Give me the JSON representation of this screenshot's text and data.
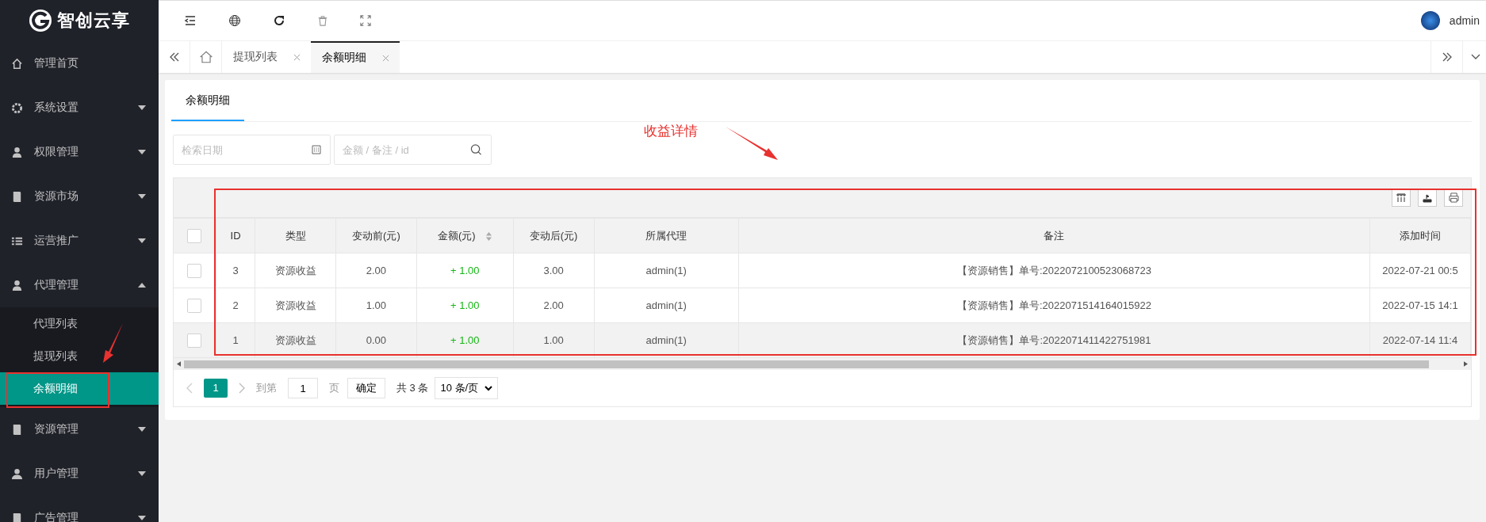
{
  "logo": {
    "text": "智创云享"
  },
  "sidebar": {
    "items": [
      {
        "label": "管理首页"
      },
      {
        "label": "系统设置",
        "expanded": false
      },
      {
        "label": "权限管理",
        "expanded": false
      },
      {
        "label": "资源市场",
        "expanded": false
      },
      {
        "label": "运营推广",
        "expanded": false
      },
      {
        "label": "代理管理",
        "expanded": true,
        "children": [
          {
            "label": "代理列表",
            "selected": false
          },
          {
            "label": "提现列表",
            "selected": false
          },
          {
            "label": "余额明细",
            "selected": true
          }
        ]
      },
      {
        "label": "资源管理",
        "expanded": false
      },
      {
        "label": "用户管理",
        "expanded": false
      },
      {
        "label": "广告管理",
        "expanded": false
      }
    ]
  },
  "header": {
    "user": "admin"
  },
  "tabs": [
    {
      "label": "提现列表",
      "selected": false
    },
    {
      "label": "余额明细",
      "selected": true
    }
  ],
  "card": {
    "tab": "余额明细"
  },
  "search": {
    "date_placeholder": "检索日期",
    "keyword_placeholder": "金额 / 备注 / id"
  },
  "table": {
    "select_all_checked": false,
    "columns": [
      "ID",
      "类型",
      "变动前(元)",
      "金额(元)",
      "变动后(元)",
      "所属代理",
      "备注",
      "添加时间"
    ],
    "rows": [
      {
        "checked": false,
        "highlighted": false,
        "cells": [
          "3",
          "资源收益",
          "2.00",
          "+ 1.00",
          "3.00",
          "admin(1)",
          "【资源销售】单号:2022072100523068723",
          "2022-07-21 00:5"
        ]
      },
      {
        "checked": false,
        "highlighted": false,
        "cells": [
          "2",
          "资源收益",
          "1.00",
          "+ 1.00",
          "2.00",
          "admin(1)",
          "【资源销售】单号:2022071514164015922",
          "2022-07-15 14:1"
        ]
      },
      {
        "checked": false,
        "highlighted": true,
        "cells": [
          "1",
          "资源收益",
          "0.00",
          "+ 1.00",
          "1.00",
          "admin(1)",
          "【资源销售】单号:2022071411422751981",
          "2022-07-14 11:4"
        ]
      }
    ]
  },
  "pagination": {
    "current": "1",
    "goto_label": "到第",
    "goto_value": "1",
    "page_label": "页",
    "confirm": "确定",
    "total": "共 3 条",
    "page_size": "10 条/页"
  },
  "annotation": {
    "label": "收益详情"
  }
}
